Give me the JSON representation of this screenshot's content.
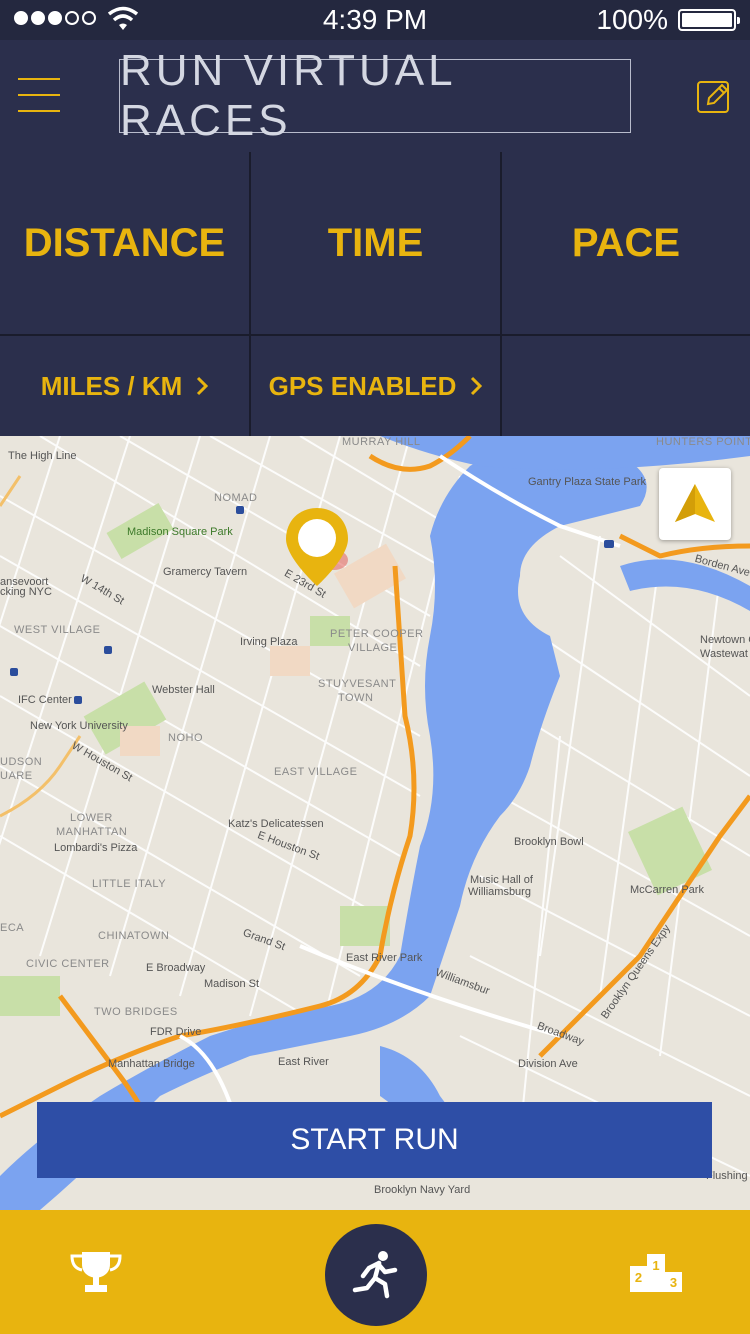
{
  "status_bar": {
    "time": "4:39 PM",
    "battery": "100%"
  },
  "header": {
    "title": "RUN VIRTUAL RACES",
    "menu_icon": "hamburger-icon",
    "edit_icon": "edit-icon"
  },
  "stats": {
    "columns": [
      "DISTANCE",
      "TIME",
      "PACE"
    ],
    "options": [
      "MILES / KM",
      "GPS ENABLED"
    ]
  },
  "map": {
    "labels": {
      "high_line": "The High Line",
      "murray_hill": "MURRAY HILL",
      "hunters_point": "HUNTERS POINT",
      "gantry": "Gantry Plaza State Park",
      "nomad": "NOMAD",
      "madison_sq": "Madison Square Park",
      "gramercy": "Gramercy Tavern",
      "e23": "E 23rd St",
      "gansevoort": "ansevoort",
      "packing": "cking NYC",
      "w14": "W 14th St",
      "west_village": "WEST VILLAGE",
      "irving": "Irving Plaza",
      "peter_cooper": "PETER COOPER",
      "village": "VILLAGE",
      "stuyvesant": "STUYVESANT",
      "town": "TOWN",
      "ifc": "IFC Center",
      "webster": "Webster Hall",
      "nyu": "New York University",
      "noho": "NOHO",
      "east_village": "EAST VILLAGE",
      "w_houston": "W Houston St",
      "lower_manhattan": "LOWER",
      "manhattan": "MANHATTAN",
      "lombardi": "Lombardi's Pizza",
      "katz": "Katz's Delicatessen",
      "e_houston": "E Houston St",
      "little_italy": "LITTLE ITALY",
      "chinatown": "CHINATOWN",
      "civic_center": "CIVIC CENTER",
      "e_broadway": "E Broadway",
      "madison_st": "Madison St",
      "grand_st": "Grand St",
      "two_bridges": "TWO BRIDGES",
      "fdr_drive": "FDR Drive",
      "manhattan_bridge": "Manhattan Bridge",
      "east_river": "East River",
      "east_river_park": "East River Park",
      "williamsburg": "Williamsbur",
      "brooklyn_bowl": "Brooklyn Bowl",
      "music_hall": "Music Hall of",
      "williamsburg2": "Williamsburg",
      "mccarren": "McCarren Park",
      "newtown": "Newtown C",
      "wastewater": "Wastewat",
      "borden": "Borden Ave",
      "broadway": "Broadway",
      "division": "Division Ave",
      "bqe": "Brooklyn Queens Expy",
      "navy_yard": "Brooklyn Navy Yard",
      "flushing": "Flushing",
      "square": "UARE",
      "judson": "UDSON",
      "eca": "ECA"
    }
  },
  "actions": {
    "start_label": "START RUN"
  },
  "tabbar": {
    "left_icon": "trophy-icon",
    "center_icon": "runner-icon",
    "right_icon": "podium-icon"
  }
}
